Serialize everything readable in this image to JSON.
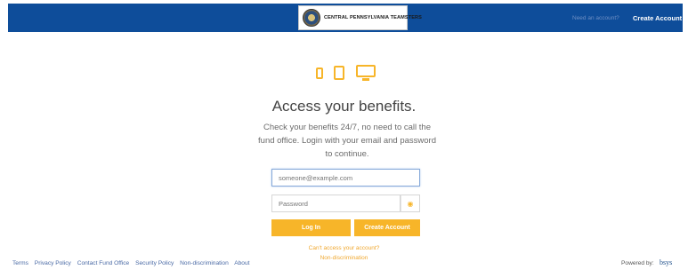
{
  "header": {
    "logo_text": "CENTRAL PENNSYLVANIA TEAMSTERS",
    "need_account": "Need an account?",
    "create_account": "Create Account"
  },
  "main": {
    "title": "Access your benefits.",
    "intro": "Check your benefits 24/7, no need to call the fund office. Login with your email and password to continue.",
    "email_placeholder": "someone@example.com",
    "password_placeholder": "Password",
    "login_label": "Log In",
    "create_label": "Create Account",
    "cant_access": "Can't access your account?",
    "nondiscrimination": "Non-discrimination"
  },
  "footer": {
    "links": [
      "Terms",
      "Privacy Policy",
      "Contact Fund Office",
      "Security Policy",
      "Non-discrimination",
      "About"
    ],
    "powered_by": "Powered by:",
    "brand": "bsys"
  },
  "colors": {
    "header_bg": "#0e4d9a",
    "accent": "#f7b529"
  },
  "icons": [
    "phone-icon",
    "tablet-icon",
    "monitor-icon",
    "eye-icon",
    "union-seal-icon"
  ]
}
